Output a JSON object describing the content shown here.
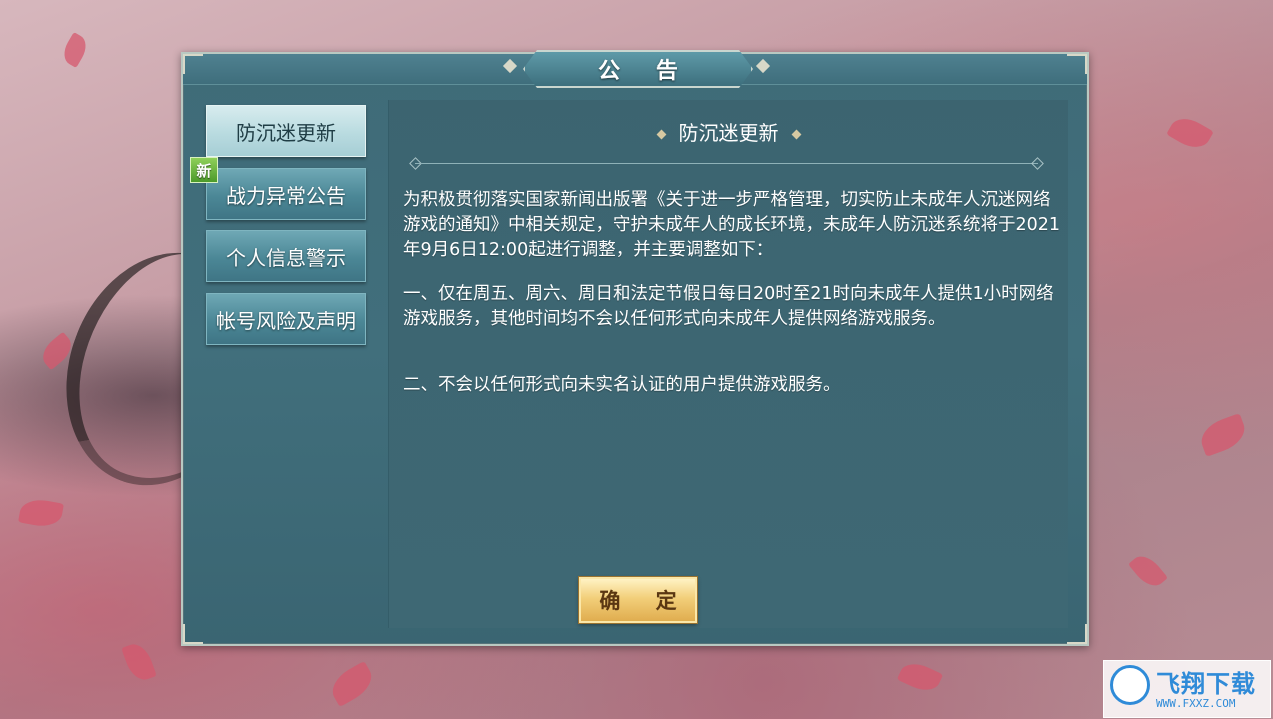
{
  "dialog": {
    "title": "公 告"
  },
  "tabs": [
    {
      "label": "防沉迷更新",
      "active": true
    },
    {
      "label": "战力异常公告",
      "active": false
    },
    {
      "label": "个人信息警示",
      "active": false
    },
    {
      "label": "帐号风险及声明",
      "active": false
    }
  ],
  "new_badge": "新",
  "content": {
    "heading": "防沉迷更新",
    "paragraphs": [
      "为积极贯彻落实国家新闻出版署《关于进一步严格管理，切实防止未成年人沉迷网络游戏的通知》中相关规定，守护未成年人的成长环境，未成年人防沉迷系统将于2021年9月6日12:00起进行调整，并主要调整如下：",
      "一、仅在周五、周六、周日和法定节假日每日20时至21时向未成年人提供1小时网络游戏服务，其他时间均不会以任何形式向未成年人提供网络游戏服务。",
      "二、不会以任何形式向未实名认证的用户提供游戏服务。"
    ]
  },
  "confirm_label": "确 定",
  "watermark": {
    "brand": "飞翔下载",
    "url": "WWW.FXXZ.COM"
  },
  "colors": {
    "panel": "#416f7c",
    "active_tab": "#b9dbe0",
    "tab": "#4b8796",
    "confirm": "#f2cf7a",
    "new_badge": "#5aa832"
  }
}
